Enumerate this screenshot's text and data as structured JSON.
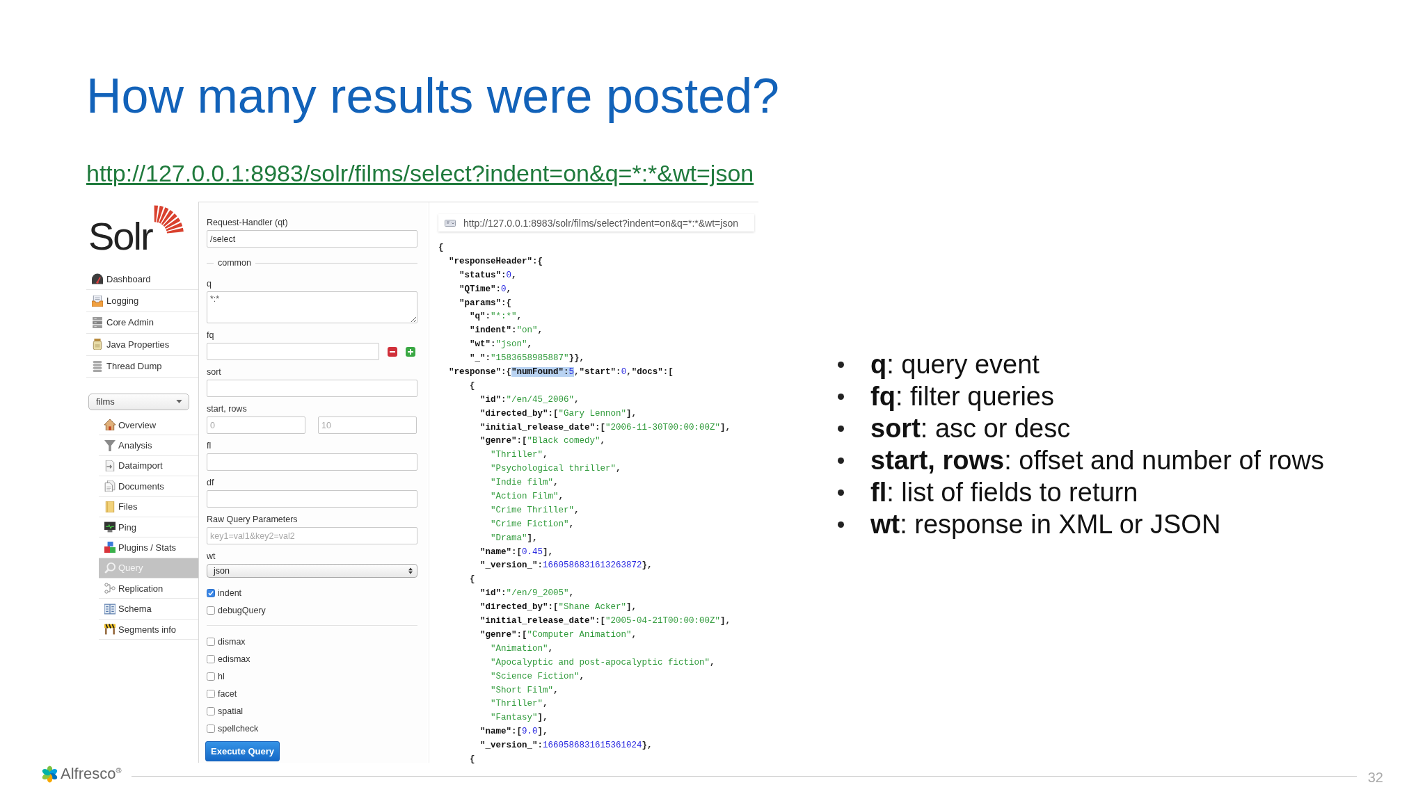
{
  "title": "How many results were posted?",
  "link": "http://127.0.0.1:8983/solr/films/select?indent=on&q=*:*&wt=json",
  "solr_ui": {
    "logo": "Solr",
    "nav": [
      {
        "label": "Dashboard",
        "selected": false
      },
      {
        "label": "Logging",
        "selected": false
      },
      {
        "label": "Core Admin",
        "selected": false
      },
      {
        "label": "Java Properties",
        "selected": false
      },
      {
        "label": "Thread Dump",
        "selected": false
      }
    ],
    "core_selector": "films",
    "core_menu": [
      {
        "label": "Overview",
        "selected": false
      },
      {
        "label": "Analysis",
        "selected": false
      },
      {
        "label": "Dataimport",
        "selected": false
      },
      {
        "label": "Documents",
        "selected": false
      },
      {
        "label": "Files",
        "selected": false
      },
      {
        "label": "Ping",
        "selected": false
      },
      {
        "label": "Plugins / Stats",
        "selected": false
      },
      {
        "label": "Query",
        "selected": true
      },
      {
        "label": "Replication",
        "selected": false
      },
      {
        "label": "Schema",
        "selected": false
      },
      {
        "label": "Segments info",
        "selected": false
      }
    ],
    "form": {
      "fields": [
        {
          "kind": "text",
          "label": "Request-Handler (qt)",
          "value": "/select"
        },
        {
          "kind": "legend",
          "label": "common"
        },
        {
          "kind": "textarea",
          "label": "q",
          "value": "*:*"
        },
        {
          "kind": "filter",
          "label": "fq"
        },
        {
          "kind": "text",
          "label": "sort"
        },
        {
          "kind": "pair",
          "label": "start, rows",
          "inputs": [
            {
              "placeholder": "0"
            },
            {
              "placeholder": "10"
            }
          ]
        },
        {
          "kind": "text",
          "label": "fl"
        },
        {
          "kind": "text",
          "label": "df"
        },
        {
          "kind": "text",
          "label": "Raw Query Parameters",
          "placeholder": "key1=val1&key2=val2"
        },
        {
          "kind": "select",
          "label": "wt",
          "value": "json"
        }
      ],
      "options": [
        {
          "label": "indent",
          "checked": true
        },
        {
          "label": "debugQuery",
          "checked": false
        }
      ],
      "handlers": [
        {
          "label": "dismax",
          "checked": false
        },
        {
          "label": "edismax",
          "checked": false
        },
        {
          "label": "hl",
          "checked": false
        },
        {
          "label": "facet",
          "checked": false
        },
        {
          "label": "spatial",
          "checked": false
        },
        {
          "label": "spellcheck",
          "checked": false
        }
      ],
      "submit": "Execute Query"
    },
    "response": {
      "url": "http://127.0.0.1:8983/solr/films/select?indent=on&q=*:*&wt=json",
      "lines": [
        {
          "tokens": [
            {
              "kind": "punct",
              "text": "{"
            }
          ]
        },
        {
          "tokens": [
            {
              "kind": "key",
              "text": "  \"responseHeader\""
            },
            {
              "kind": "punct",
              "text": ":{"
            }
          ]
        },
        {
          "tokens": [
            {
              "kind": "key",
              "text": "    \"status\""
            },
            {
              "kind": "punct",
              "text": ":"
            },
            {
              "kind": "number",
              "text": "0"
            },
            {
              "kind": "punct",
              "text": ","
            }
          ]
        },
        {
          "tokens": [
            {
              "kind": "key",
              "text": "    \"QTime\""
            },
            {
              "kind": "punct",
              "text": ":"
            },
            {
              "kind": "number",
              "text": "0"
            },
            {
              "kind": "punct",
              "text": ","
            }
          ]
        },
        {
          "tokens": [
            {
              "kind": "key",
              "text": "    \"params\""
            },
            {
              "kind": "punct",
              "text": ":{"
            }
          ]
        },
        {
          "tokens": [
            {
              "kind": "key",
              "text": "      \"q\""
            },
            {
              "kind": "punct",
              "text": ":"
            },
            {
              "kind": "string",
              "text": "\"*:*\""
            },
            {
              "kind": "punct",
              "text": ","
            }
          ]
        },
        {
          "tokens": [
            {
              "kind": "key",
              "text": "      \"indent\""
            },
            {
              "kind": "punct",
              "text": ":"
            },
            {
              "kind": "string",
              "text": "\"on\""
            },
            {
              "kind": "punct",
              "text": ","
            }
          ]
        },
        {
          "tokens": [
            {
              "kind": "key",
              "text": "      \"wt\""
            },
            {
              "kind": "punct",
              "text": ":"
            },
            {
              "kind": "string",
              "text": "\"json\""
            },
            {
              "kind": "punct",
              "text": ","
            }
          ]
        },
        {
          "tokens": [
            {
              "kind": "key",
              "text": "      \"_\""
            },
            {
              "kind": "punct",
              "text": ":"
            },
            {
              "kind": "string",
              "text": "\"1583658985887\""
            },
            {
              "kind": "punct",
              "text": "}},"
            }
          ]
        },
        {
          "tokens": [
            {
              "kind": "key",
              "text": "  \"response\""
            },
            {
              "kind": "punct",
              "text": ":{"
            },
            {
              "kind": "selection",
              "tokens": [
                {
                  "kind": "key",
                  "text": "\"numFound\""
                },
                {
                  "kind": "punct",
                  "text": ":"
                },
                {
                  "kind": "number",
                  "text": "5"
                }
              ]
            },
            {
              "kind": "punct",
              "text": ","
            },
            {
              "kind": "key",
              "text": "\"start\""
            },
            {
              "kind": "punct",
              "text": ":"
            },
            {
              "kind": "number",
              "text": "0"
            },
            {
              "kind": "punct",
              "text": ","
            },
            {
              "kind": "key",
              "text": "\"docs\""
            },
            {
              "kind": "punct",
              "text": ":["
            }
          ]
        },
        {
          "tokens": [
            {
              "kind": "punct",
              "text": "      {"
            }
          ]
        },
        {
          "tokens": [
            {
              "kind": "key",
              "text": "        \"id\""
            },
            {
              "kind": "punct",
              "text": ":"
            },
            {
              "kind": "string",
              "text": "\"/en/45_2006\""
            },
            {
              "kind": "punct",
              "text": ","
            }
          ]
        },
        {
          "tokens": [
            {
              "kind": "key",
              "text": "        \"directed_by\""
            },
            {
              "kind": "punct",
              "text": ":["
            },
            {
              "kind": "string",
              "text": "\"Gary Lennon\""
            },
            {
              "kind": "punct",
              "text": "],"
            }
          ]
        },
        {
          "tokens": [
            {
              "kind": "key",
              "text": "        \"initial_release_date\""
            },
            {
              "kind": "punct",
              "text": ":["
            },
            {
              "kind": "string",
              "text": "\"2006-11-30T00:00:00Z\""
            },
            {
              "kind": "punct",
              "text": "],"
            }
          ]
        },
        {
          "tokens": [
            {
              "kind": "key",
              "text": "        \"genre\""
            },
            {
              "kind": "punct",
              "text": ":["
            },
            {
              "kind": "string",
              "text": "\"Black comedy\""
            },
            {
              "kind": "punct",
              "text": ","
            }
          ]
        },
        {
          "tokens": [
            {
              "kind": "string",
              "text": "          \"Thriller\""
            },
            {
              "kind": "punct",
              "text": ","
            }
          ]
        },
        {
          "tokens": [
            {
              "kind": "string",
              "text": "          \"Psychological thriller\""
            },
            {
              "kind": "punct",
              "text": ","
            }
          ]
        },
        {
          "tokens": [
            {
              "kind": "string",
              "text": "          \"Indie film\""
            },
            {
              "kind": "punct",
              "text": ","
            }
          ]
        },
        {
          "tokens": [
            {
              "kind": "string",
              "text": "          \"Action Film\""
            },
            {
              "kind": "punct",
              "text": ","
            }
          ]
        },
        {
          "tokens": [
            {
              "kind": "string",
              "text": "          \"Crime Thriller\""
            },
            {
              "kind": "punct",
              "text": ","
            }
          ]
        },
        {
          "tokens": [
            {
              "kind": "string",
              "text": "          \"Crime Fiction\""
            },
            {
              "kind": "punct",
              "text": ","
            }
          ]
        },
        {
          "tokens": [
            {
              "kind": "string",
              "text": "          \"Drama\""
            },
            {
              "kind": "punct",
              "text": "],"
            }
          ]
        },
        {
          "tokens": [
            {
              "kind": "key",
              "text": "        \"name\""
            },
            {
              "kind": "punct",
              "text": ":["
            },
            {
              "kind": "number",
              "text": "0.45"
            },
            {
              "kind": "punct",
              "text": "],"
            }
          ]
        },
        {
          "tokens": [
            {
              "kind": "key",
              "text": "        \"_version_\""
            },
            {
              "kind": "punct",
              "text": ":"
            },
            {
              "kind": "number",
              "text": "1660586831613263872"
            },
            {
              "kind": "punct",
              "text": "},"
            }
          ]
        },
        {
          "tokens": [
            {
              "kind": "punct",
              "text": "      {"
            }
          ]
        },
        {
          "tokens": [
            {
              "kind": "key",
              "text": "        \"id\""
            },
            {
              "kind": "punct",
              "text": ":"
            },
            {
              "kind": "string",
              "text": "\"/en/9_2005\""
            },
            {
              "kind": "punct",
              "text": ","
            }
          ]
        },
        {
          "tokens": [
            {
              "kind": "key",
              "text": "        \"directed_by\""
            },
            {
              "kind": "punct",
              "text": ":["
            },
            {
              "kind": "string",
              "text": "\"Shane Acker\""
            },
            {
              "kind": "punct",
              "text": "],"
            }
          ]
        },
        {
          "tokens": [
            {
              "kind": "key",
              "text": "        \"initial_release_date\""
            },
            {
              "kind": "punct",
              "text": ":["
            },
            {
              "kind": "string",
              "text": "\"2005-04-21T00:00:00Z\""
            },
            {
              "kind": "punct",
              "text": "],"
            }
          ]
        },
        {
          "tokens": [
            {
              "kind": "key",
              "text": "        \"genre\""
            },
            {
              "kind": "punct",
              "text": ":["
            },
            {
              "kind": "string",
              "text": "\"Computer Animation\""
            },
            {
              "kind": "punct",
              "text": ","
            }
          ]
        },
        {
          "tokens": [
            {
              "kind": "string",
              "text": "          \"Animation\""
            },
            {
              "kind": "punct",
              "text": ","
            }
          ]
        },
        {
          "tokens": [
            {
              "kind": "string",
              "text": "          \"Apocalyptic and post-apocalyptic fiction\""
            },
            {
              "kind": "punct",
              "text": ","
            }
          ]
        },
        {
          "tokens": [
            {
              "kind": "string",
              "text": "          \"Science Fiction\""
            },
            {
              "kind": "punct",
              "text": ","
            }
          ]
        },
        {
          "tokens": [
            {
              "kind": "string",
              "text": "          \"Short Film\""
            },
            {
              "kind": "punct",
              "text": ","
            }
          ]
        },
        {
          "tokens": [
            {
              "kind": "string",
              "text": "          \"Thriller\""
            },
            {
              "kind": "punct",
              "text": ","
            }
          ]
        },
        {
          "tokens": [
            {
              "kind": "string",
              "text": "          \"Fantasy\""
            },
            {
              "kind": "punct",
              "text": "],"
            }
          ]
        },
        {
          "tokens": [
            {
              "kind": "key",
              "text": "        \"name\""
            },
            {
              "kind": "punct",
              "text": ":["
            },
            {
              "kind": "number",
              "text": "9.0"
            },
            {
              "kind": "punct",
              "text": "],"
            }
          ]
        },
        {
          "tokens": [
            {
              "kind": "key",
              "text": "        \"_version_\""
            },
            {
              "kind": "punct",
              "text": ":"
            },
            {
              "kind": "number",
              "text": "1660586831615361024"
            },
            {
              "kind": "punct",
              "text": "},"
            }
          ]
        },
        {
          "tokens": [
            {
              "kind": "punct",
              "text": "      {"
            }
          ]
        }
      ]
    }
  },
  "bullets": [
    "**q**: query event",
    "**fq**: filter queries",
    "**sort**: asc or desc",
    "**start, rows**: offset and number of rows",
    "**fl**: list of fields to return",
    "**wt**: response in XML or JSON"
  ],
  "footer": {
    "logo": "Alfresco$^{®}$",
    "page_number": "32"
  }
}
